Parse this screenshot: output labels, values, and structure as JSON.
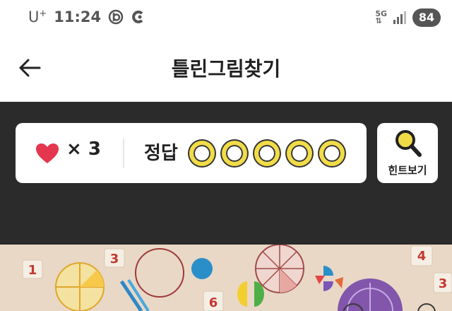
{
  "status_bar": {
    "carrier": "U",
    "carrier_sup": "+",
    "time": "11:24",
    "network": "5G",
    "battery": "84"
  },
  "app_bar": {
    "title": "틀린그림찾기"
  },
  "score": {
    "lives_text": "× 3",
    "answer_label": "정답",
    "answers_total": 5,
    "answers_found": 0
  },
  "hint": {
    "label": "힌트보기"
  },
  "puzzle": {
    "tiles": [
      "1",
      "3",
      "6",
      "4",
      "3"
    ],
    "shapes": [
      "fraction-circle",
      "fraction-circle",
      "protractor",
      "blocks",
      "pencils"
    ]
  },
  "colors": {
    "heart": "#e4364e",
    "answer_ring": "#f1dc47",
    "dark_panel": "#2b2b2b",
    "tile_number": "#c4372f"
  }
}
